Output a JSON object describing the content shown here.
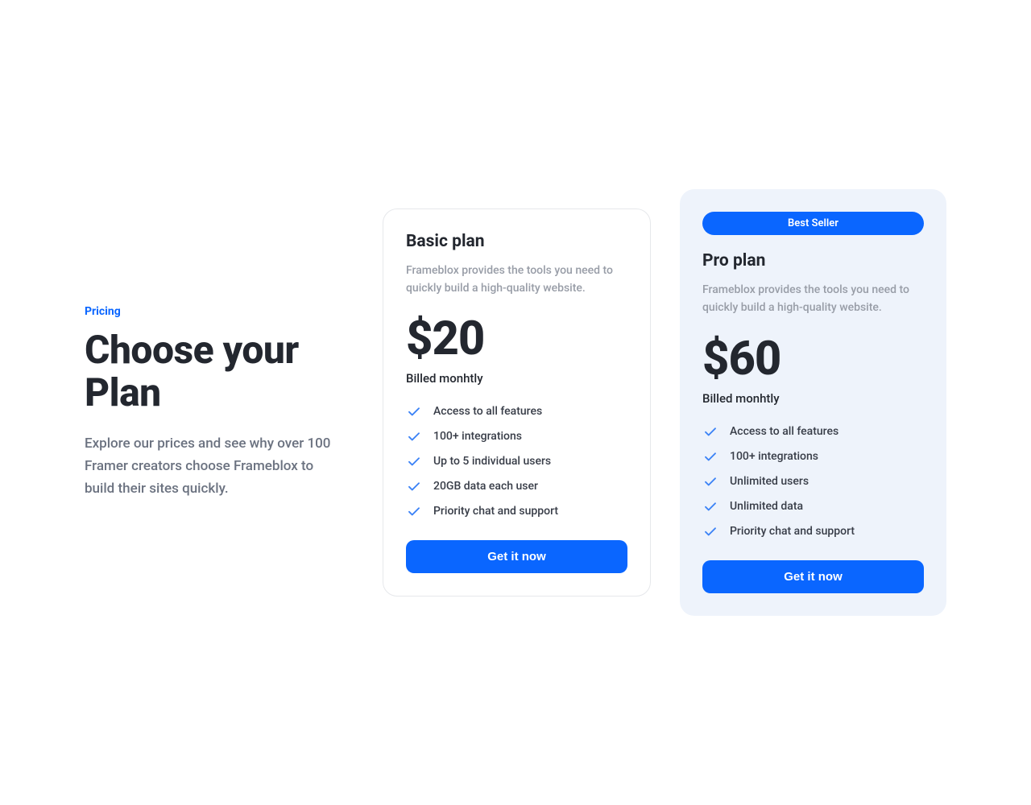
{
  "intro": {
    "eyebrow": "Pricing",
    "heading": "Choose your Plan",
    "subheading": "Explore our prices and see why over 100 Framer creators choose Frameblox to build their sites quickly."
  },
  "plans": {
    "basic": {
      "title": "Basic plan",
      "description": "Frameblox provides the tools you need to quickly build a high-quality website.",
      "price": "$20",
      "billing": "Billed monhtly",
      "features": [
        "Access to all features",
        "100+ integrations",
        "Up to 5 individual users",
        "20GB data each user",
        "Priority chat and support"
      ],
      "cta": "Get it now"
    },
    "pro": {
      "badge": "Best Seller",
      "title": "Pro plan",
      "description": "Frameblox provides the tools you need to quickly build a high-quality website.",
      "price": "$60",
      "billing": "Billed monhtly",
      "features": [
        "Access to all features",
        "100+ integrations",
        "Unlimited users",
        "Unlimited data",
        "Priority chat and support"
      ],
      "cta": "Get it now"
    }
  }
}
